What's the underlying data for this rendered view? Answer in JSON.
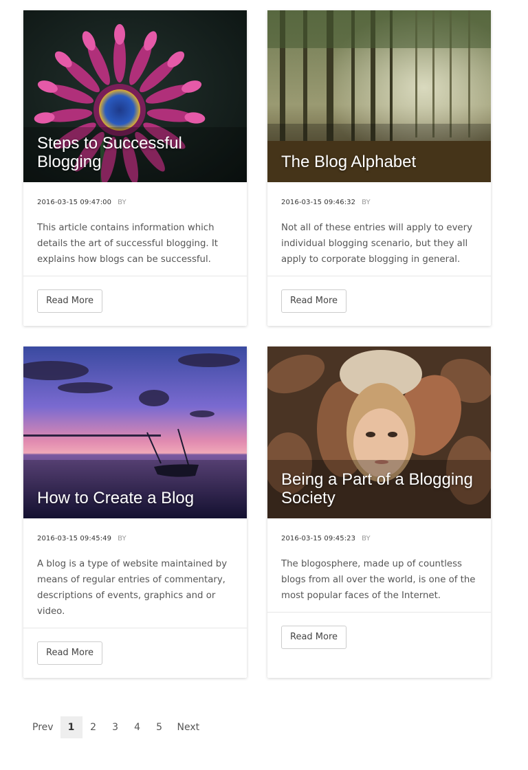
{
  "posts": [
    {
      "title": "Steps to Successful Blogging",
      "date": "2016-03-15 09:47:00",
      "by": "BY",
      "excerpt": "This article contains information which details the art of successful blogging. It explains how blogs can be successful.",
      "button": "Read More"
    },
    {
      "title": "The Blog Alphabet",
      "date": "2016-03-15 09:46:32",
      "by": "BY",
      "excerpt": "Not all of these entries will apply to every individual blogging scenario, but they all apply to corporate blogging in general.",
      "button": "Read More"
    },
    {
      "title": "How to Create a Blog",
      "date": "2016-03-15 09:45:49",
      "by": "BY",
      "excerpt": "A blog is a type of website maintained by means of regular entries of commentary, descriptions of events, graphics and or video.",
      "button": "Read More"
    },
    {
      "title": "Being a Part of a Blogging Society",
      "date": "2016-03-15 09:45:23",
      "by": "BY",
      "excerpt": "The blogosphere, made up of countless blogs from all over the world, is one of the most popular faces of the Internet.",
      "button": "Read More"
    }
  ],
  "pagination": {
    "prev": "Prev",
    "pages": [
      "1",
      "2",
      "3",
      "4",
      "5"
    ],
    "active": "1",
    "next": "Next"
  }
}
